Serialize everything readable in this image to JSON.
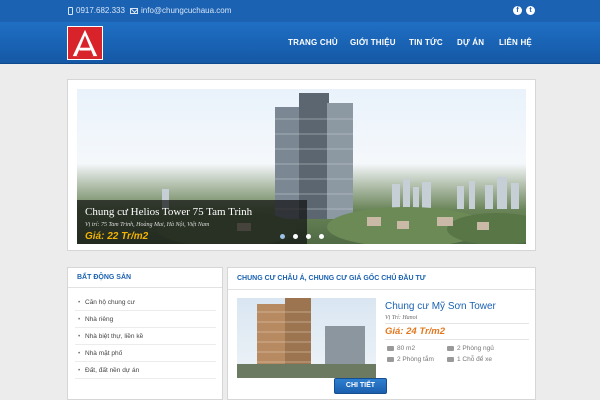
{
  "topbar": {
    "phone": "0917.682.333",
    "email": "info@chungcuchaua.com",
    "social": [
      {
        "icon": "facebook-icon",
        "glyph": "f"
      },
      {
        "icon": "twitter-icon",
        "glyph": "t"
      }
    ]
  },
  "colors": {
    "brand_blue": "#1b62b2",
    "logo_red": "#d8232a",
    "price_orange": "#e2781e",
    "caption_gold": "#f2b400"
  },
  "nav": [
    "TRANG CHỦ",
    "GIỚI THIỆU",
    "TIN TỨC",
    "DỰ ÁN",
    "LIÊN HỆ"
  ],
  "slider": {
    "title": "Chung cư Helios Tower 75 Tam Trinh",
    "location": "Vị trí: 75 Tam Trinh, Hoàng Mai, Hà Nội, Việt Nam",
    "price": "Giá: 22 Tr/m2",
    "dots": 4,
    "active_dot": 1
  },
  "sidebar": {
    "title": "BẤT ĐỘNG SẢN",
    "items": [
      "Căn hộ chung cư",
      "Nhà riêng",
      "Nhà biệt thự, liền kề",
      "Nhà mặt phố",
      "Đất, đất nền dự án"
    ]
  },
  "main": {
    "title": "CHUNG CƯ CHÂU Á, CHUNG CƯ GIÁ GỐC CHỦ ĐẦU TƯ",
    "project": {
      "name": "Chung cư Mỹ Sơn Tower",
      "location": "Vị Trí: Hanoi",
      "price": "Giá: 24 Tr/m2",
      "area": "80 m2",
      "bedrooms": "2 Phòng ngủ",
      "bathrooms": "2 Phòng tắm",
      "parking": "1 Chỗ để xe",
      "button": "CHI TIẾT"
    }
  }
}
